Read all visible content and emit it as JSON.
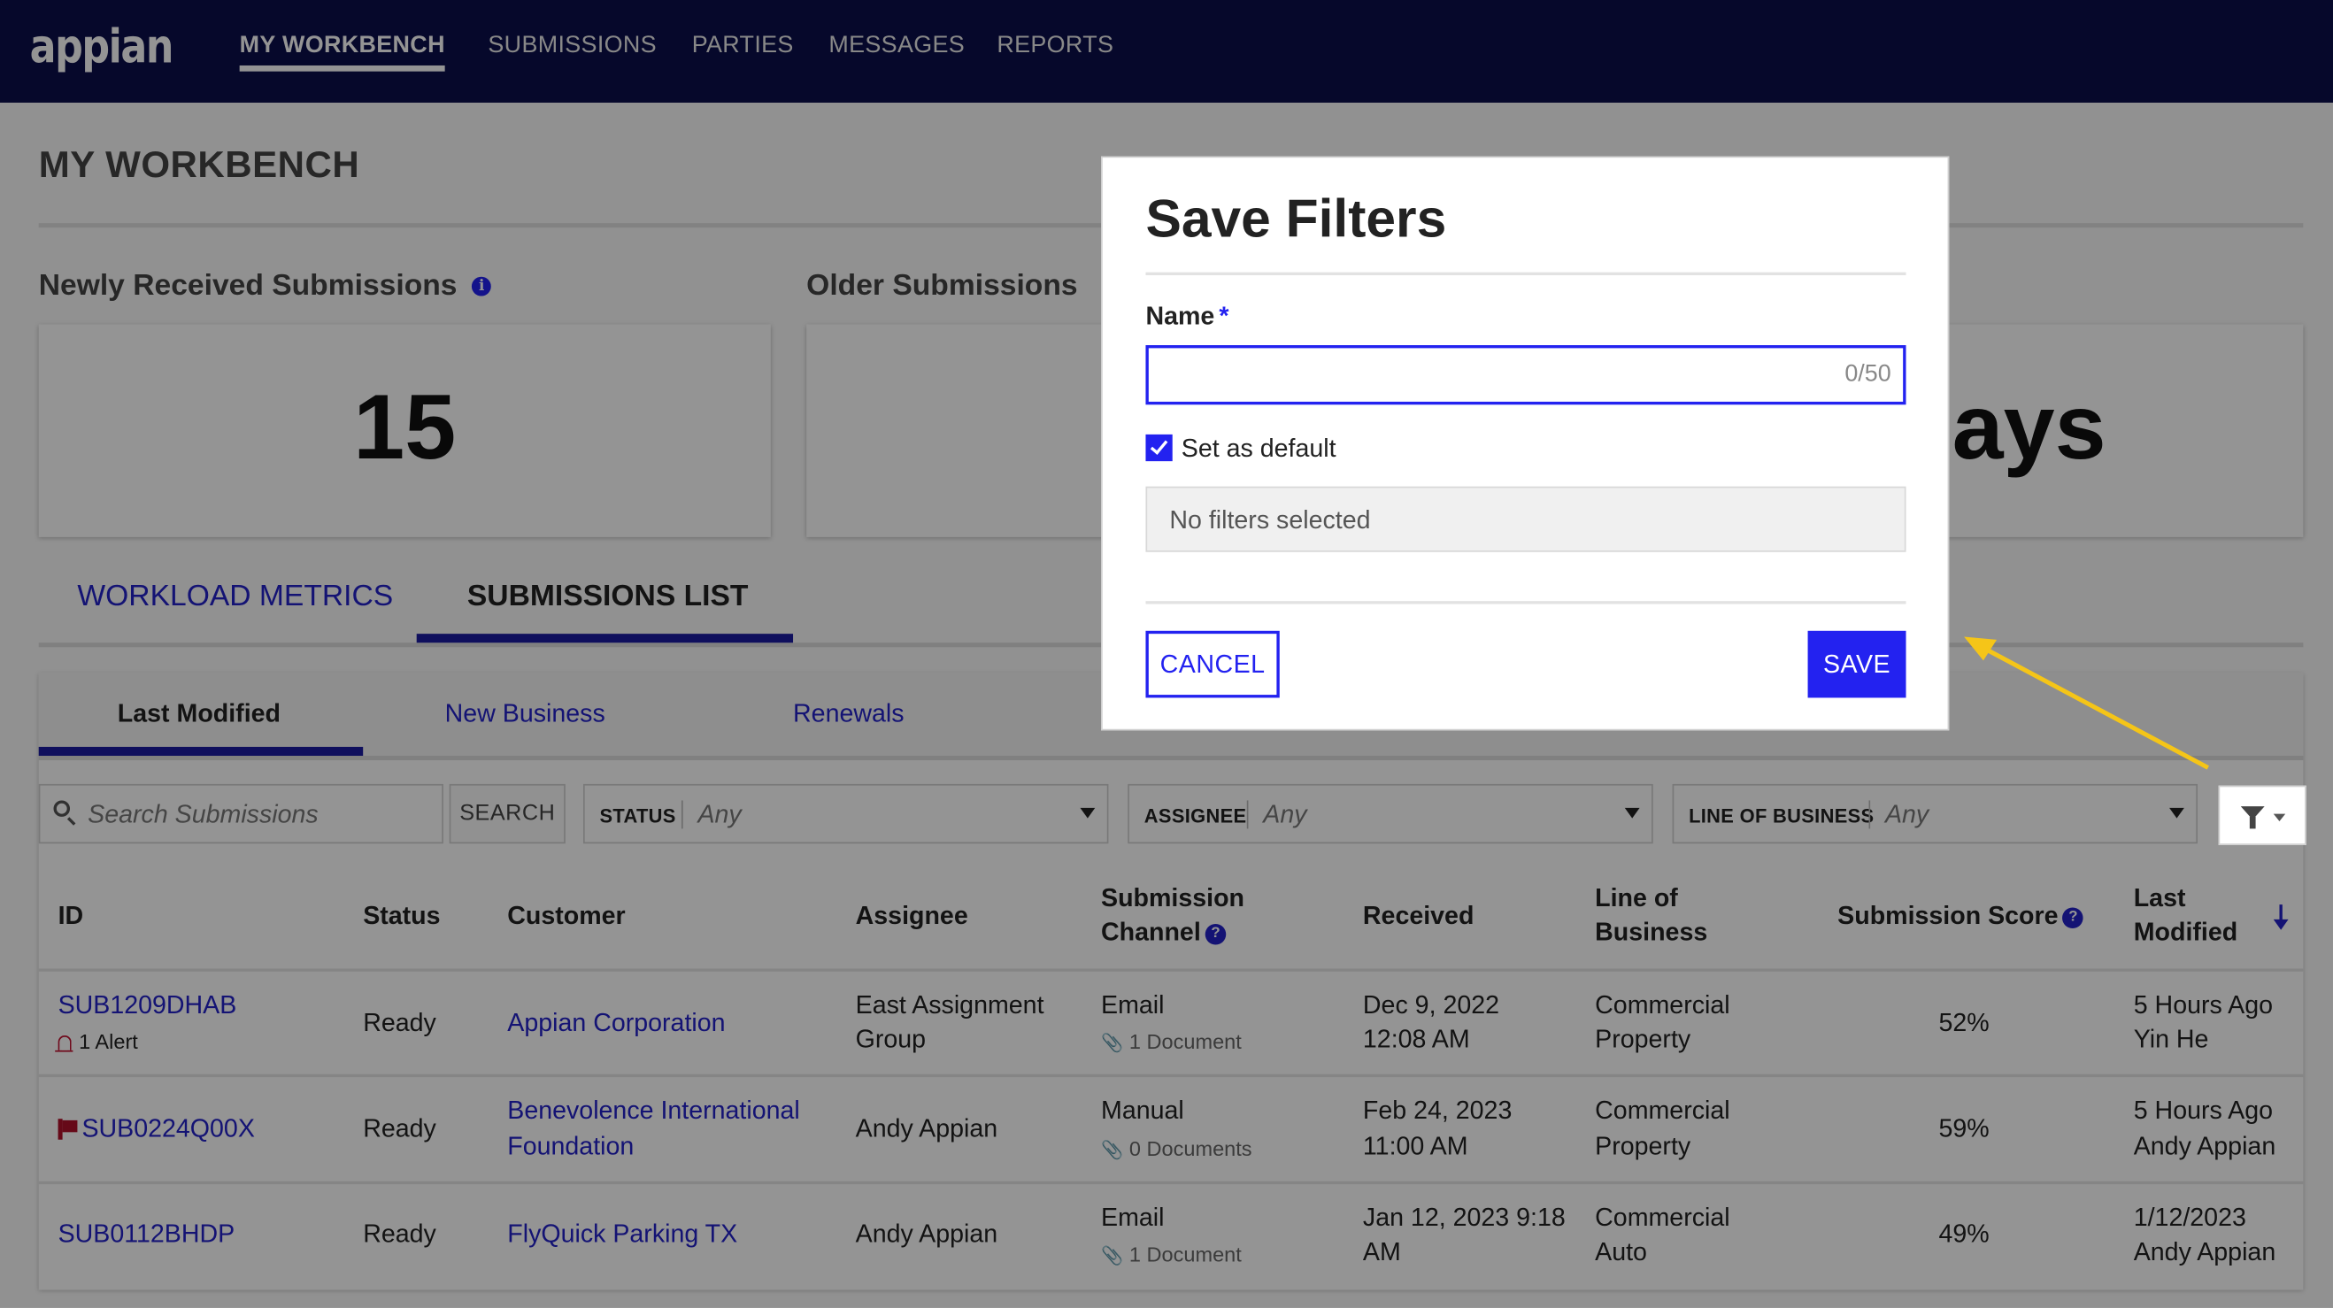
{
  "app": {
    "logo": "appian",
    "nav": [
      {
        "label": "MY WORKBENCH",
        "active": true
      },
      {
        "label": "SUBMISSIONS",
        "active": false
      },
      {
        "label": "PARTIES",
        "active": false
      },
      {
        "label": "MESSAGES",
        "active": false
      },
      {
        "label": "REPORTS",
        "active": false
      }
    ]
  },
  "page": {
    "title": "MY WORKBENCH",
    "kpis": [
      {
        "label": "Newly Received Submissions",
        "value": "15",
        "icon": "info-icon"
      },
      {
        "label": "Older Submissions",
        "value": ""
      },
      {
        "label": "",
        "value": "ays"
      }
    ],
    "main_tabs": [
      {
        "label": "WORKLOAD METRICS",
        "active": false
      },
      {
        "label": "SUBMISSIONS LIST",
        "active": true
      }
    ],
    "sub_tabs": [
      {
        "label": "Last Modified",
        "active": true
      },
      {
        "label": "New Business",
        "active": false
      },
      {
        "label": "Renewals",
        "active": false
      }
    ],
    "filters": {
      "search_placeholder": "Search Submissions",
      "search_button": "SEARCH",
      "dropdowns": [
        {
          "label": "STATUS",
          "value": "Any"
        },
        {
          "label": "ASSIGNEE",
          "value": "Any"
        },
        {
          "label": "LINE OF BUSINESS",
          "value": "Any"
        }
      ],
      "filter_menu_icon": "funnel-icon"
    },
    "table": {
      "columns": {
        "id": "ID",
        "status": "Status",
        "customer": "Customer",
        "assignee": "Assignee",
        "channel_l1": "Submission",
        "channel_l2": "Channel",
        "received": "Received",
        "lob_l1": "Line of",
        "lob_l2": "Business",
        "score": "Submission Score",
        "modified_l1": "Last",
        "modified_l2": "Modified"
      },
      "sort": {
        "column": "Last Modified",
        "direction": "descending"
      },
      "rows": [
        {
          "id": "SUB1209DHAB",
          "alert": "1 Alert",
          "flag": false,
          "status": "Ready",
          "customer_l1": "Appian Corporation",
          "customer_l2": "",
          "assignee_l1": "East Assignment",
          "assignee_l2": "Group",
          "channel": "Email",
          "documents": "1 Document",
          "received_l1": "Dec 9, 2022",
          "received_l2": "12:08 AM",
          "lob_l1": "Commercial",
          "lob_l2": "Property",
          "score": "52%",
          "modified_l1": "5 Hours Ago",
          "modified_l2": "Yin He"
        },
        {
          "id": "SUB0224Q00X",
          "alert": "",
          "flag": true,
          "status": "Ready",
          "customer_l1": "Benevolence International",
          "customer_l2": "Foundation",
          "assignee_l1": "Andy Appian",
          "assignee_l2": "",
          "channel": "Manual",
          "documents": "0 Documents",
          "received_l1": "Feb 24, 2023",
          "received_l2": "11:00 AM",
          "lob_l1": "Commercial",
          "lob_l2": "Property",
          "score": "59%",
          "modified_l1": "5 Hours Ago",
          "modified_l2": "Andy Appian"
        },
        {
          "id": "SUB0112BHDP",
          "alert": "",
          "flag": false,
          "status": "Ready",
          "customer_l1": "FlyQuick Parking TX",
          "customer_l2": "",
          "assignee_l1": "Andy Appian",
          "assignee_l2": "",
          "channel": "Email",
          "documents": "1 Document",
          "received_l1": "Jan 12, 2023 9:18",
          "received_l2": "AM",
          "lob_l1": "Commercial",
          "lob_l2": "Auto",
          "score": "49%",
          "modified_l1": "1/12/2023",
          "modified_l2": "Andy Appian"
        }
      ]
    }
  },
  "modal": {
    "title": "Save Filters",
    "name_label": "Name",
    "required_mark": "*",
    "name_value": "",
    "counter": "0/50",
    "set_default_label": "Set as default",
    "set_default_checked": true,
    "filters_summary": "No filters selected",
    "cancel_label": "CANCEL",
    "save_label": "SAVE"
  },
  "colors": {
    "nav_bg": "#0b0f4a",
    "accent": "#2322f0",
    "link": "#2322c8",
    "alert": "#c01030",
    "annotation_arrow": "#f5c518"
  }
}
